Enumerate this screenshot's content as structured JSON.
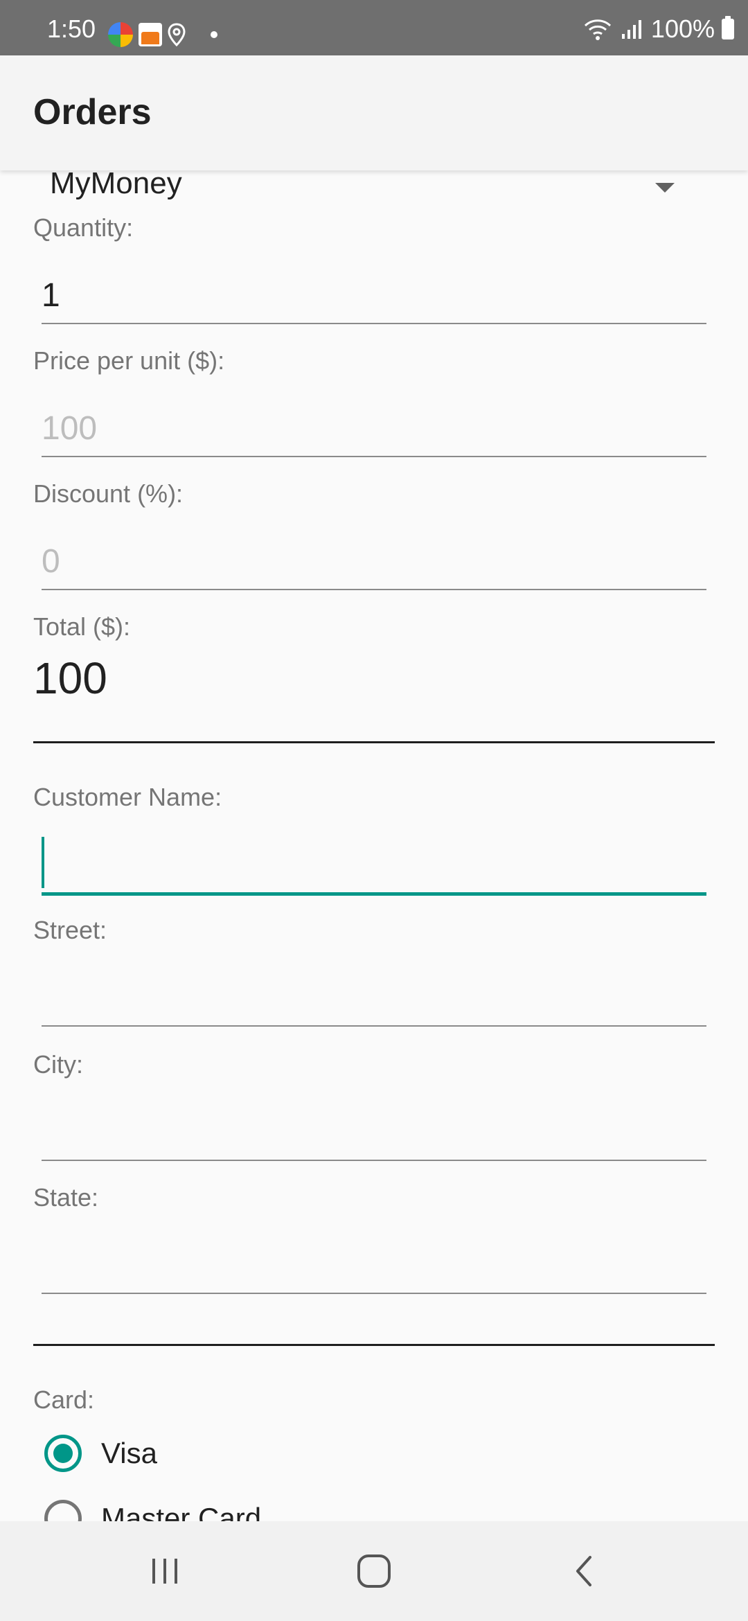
{
  "status_bar": {
    "time": "1:50",
    "battery": "100%"
  },
  "app_bar": {
    "title": "Orders"
  },
  "form": {
    "product_spinner": {
      "value": "MyMoney"
    },
    "quantity": {
      "label": "Quantity:",
      "value": "1"
    },
    "price": {
      "label": "Price per unit ($):",
      "value": "100"
    },
    "discount": {
      "label": "Discount (%):",
      "value": "0"
    },
    "total": {
      "label": "Total ($):",
      "value": "100"
    },
    "customer_name": {
      "label": "Customer Name:",
      "value": ""
    },
    "street": {
      "label": "Street:",
      "value": ""
    },
    "city": {
      "label": "City:",
      "value": ""
    },
    "state": {
      "label": "State:",
      "value": ""
    },
    "card": {
      "label": "Card:",
      "options": [
        {
          "label": "Visa",
          "checked": true
        },
        {
          "label": "Master Card",
          "checked": false
        }
      ]
    }
  },
  "colors": {
    "accent": "#009688",
    "status_bar": "#6f6f6f",
    "app_bar": "#f4f4f4",
    "background": "#fafafa"
  },
  "icons": {
    "nav_recents": "recents-icon",
    "nav_home": "home-icon",
    "nav_back": "back-icon"
  }
}
